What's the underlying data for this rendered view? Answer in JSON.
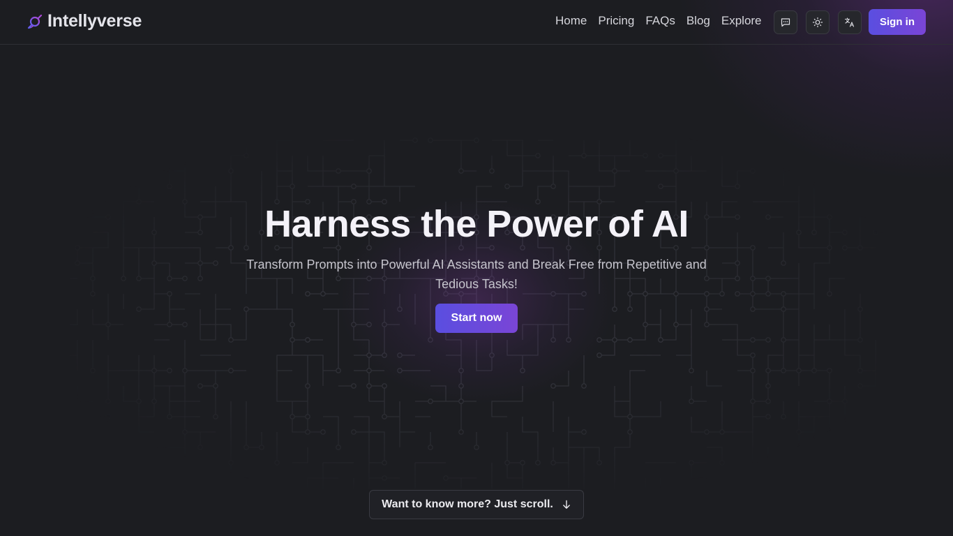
{
  "brand": {
    "name": "Intellyverse",
    "logo_icon": "planet-icon",
    "accent": "#6a4de0"
  },
  "nav": {
    "items": [
      {
        "label": "Home"
      },
      {
        "label": "Pricing"
      },
      {
        "label": "FAQs"
      },
      {
        "label": "Blog"
      },
      {
        "label": "Explore"
      }
    ]
  },
  "toolbar": {
    "chat_icon": "chat-bubble-icon",
    "theme_icon": "sun-icon",
    "language_icon": "translate-icon",
    "signin_label": "Sign in"
  },
  "hero": {
    "title": "Harness the Power of AI",
    "subtitle": "Transform Prompts into Powerful AI Assistants and Break Free from Repetitive and Tedious Tasks!",
    "cta_label": "Start now"
  },
  "scroll_hint": {
    "label": "Want to know more? Just scroll.",
    "icon": "arrow-down-icon"
  }
}
